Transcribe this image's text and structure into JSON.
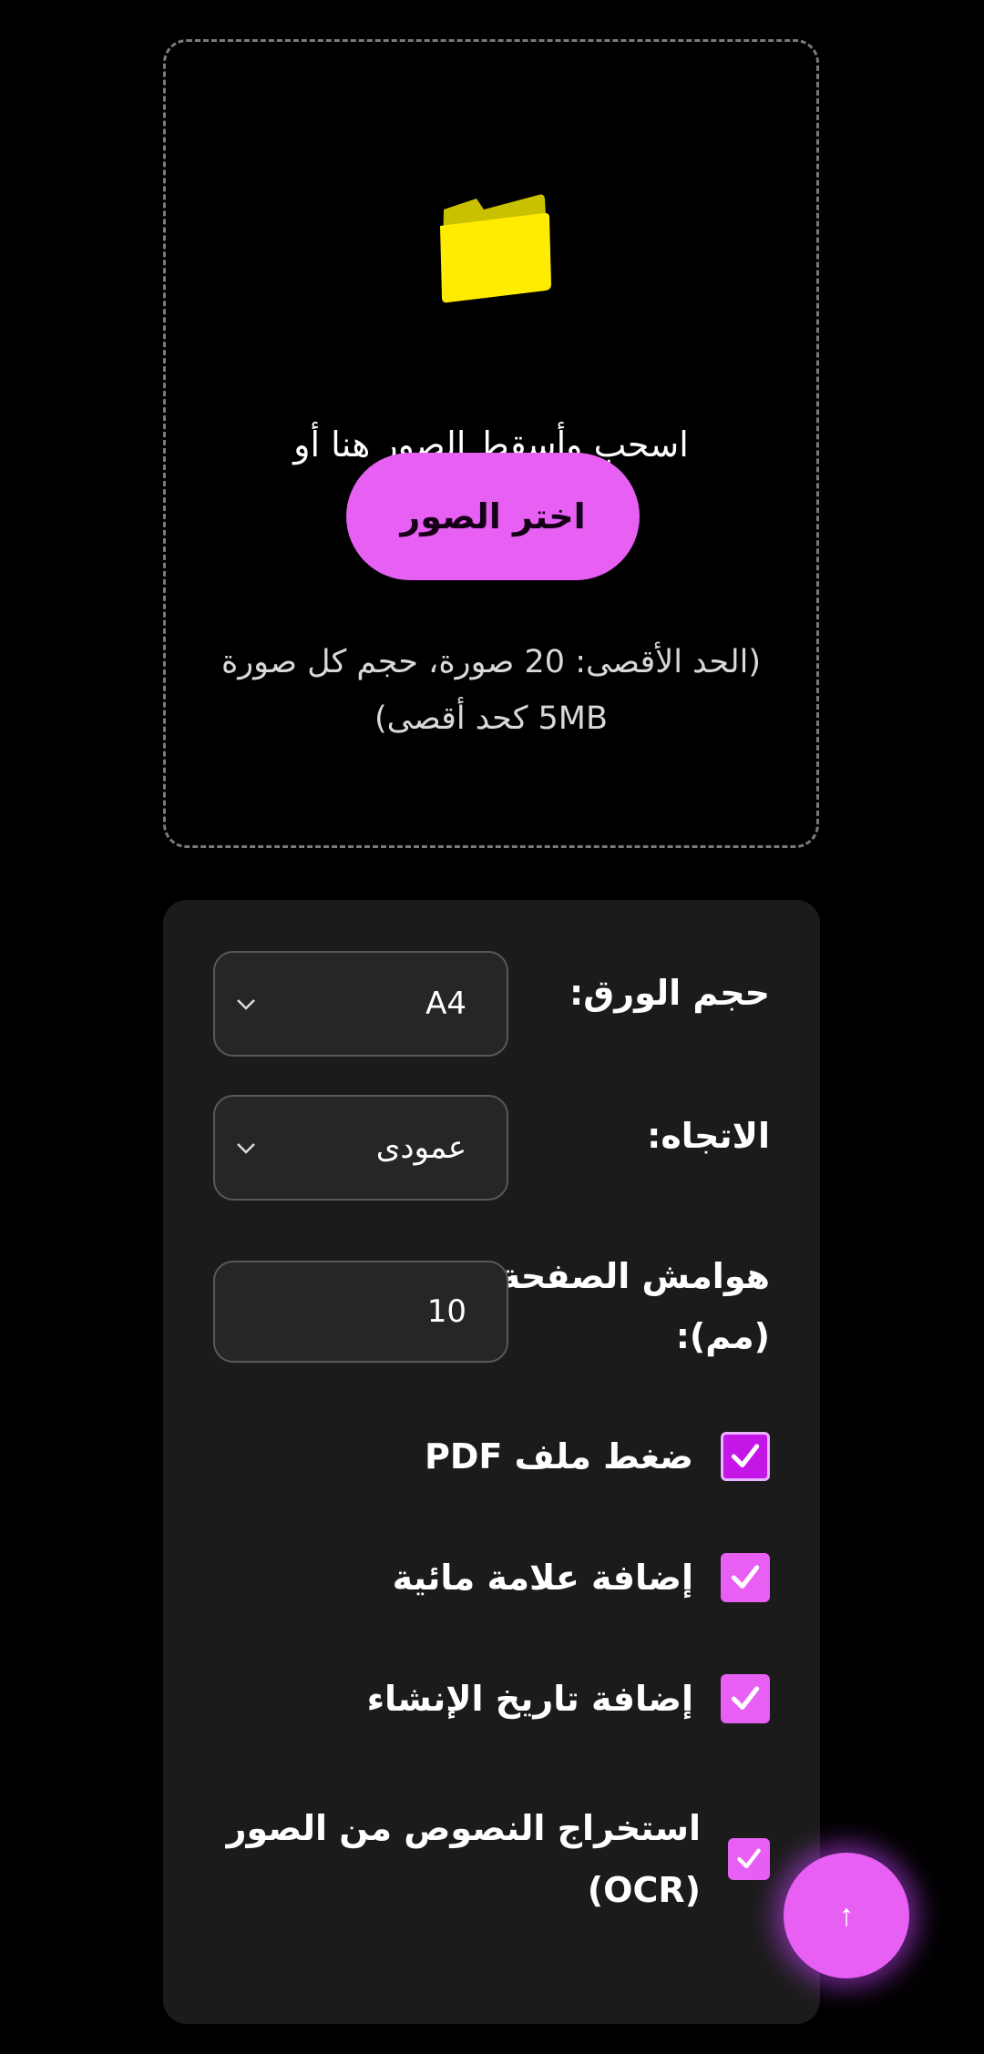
{
  "upload": {
    "drop_text": "اسحب وأسقط الصور هنا أو",
    "choose_button": "اختر الصور",
    "limits_line1": "(الحد الأقصى: 20 صورة، حجم كل صورة",
    "limits_line2": "5MB كحد أقصى)",
    "icon": "folder-icon"
  },
  "settings": {
    "paper_size": {
      "label": "حجم الورق:",
      "value": "A4"
    },
    "orientation": {
      "label": "الاتجاه:",
      "value": "عمودى"
    },
    "margins": {
      "label_line1": "هوامش الصفحة",
      "label_line2": "(مم):",
      "value": "10"
    },
    "options": [
      {
        "label": "ضغط ملف PDF",
        "checked": true
      },
      {
        "label": "إضافة علامة مائية",
        "checked": true
      },
      {
        "label": "إضافة تاريخ الإنشاء",
        "checked": true
      },
      {
        "label_line1": "استخراج النصوص من الصور",
        "label_line2": "(OCR)",
        "checked": true
      }
    ]
  },
  "fab": {
    "symbol": "↑"
  },
  "colors": {
    "accent": "#e85ff4",
    "background": "#000000",
    "card": "#1b1b1b"
  }
}
